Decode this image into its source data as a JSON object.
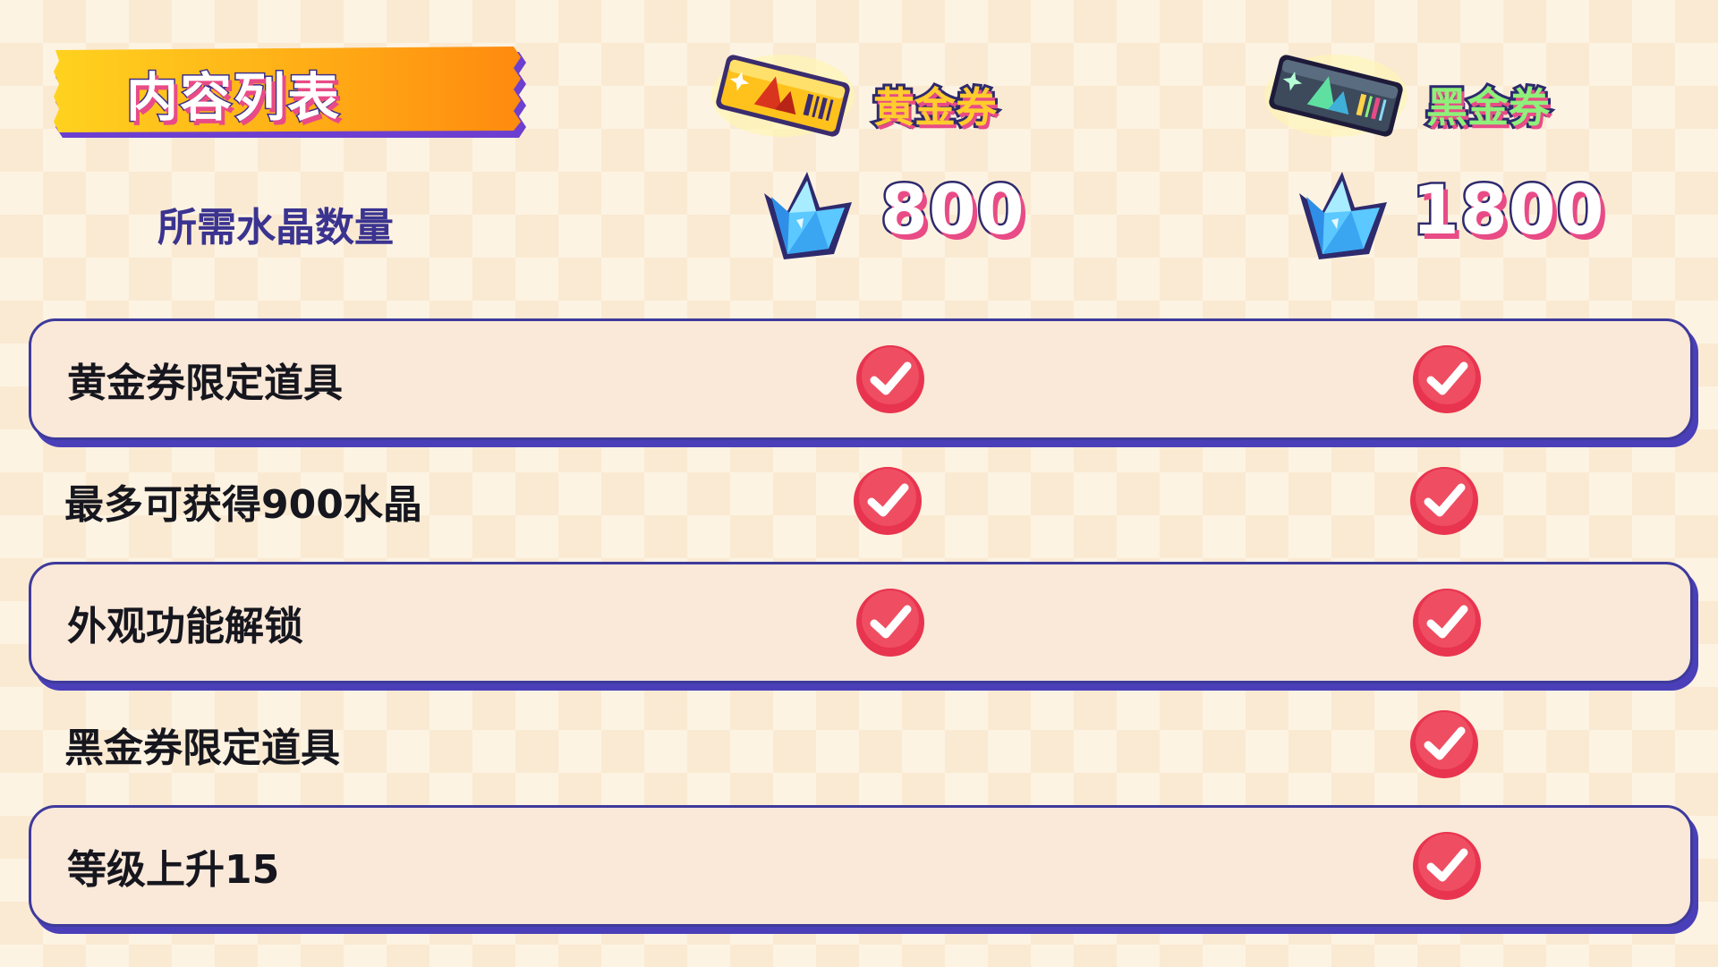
{
  "header": {
    "title": "内容列表",
    "crystal_label": "所需水晶数量"
  },
  "passes": {
    "gold": {
      "name": "黄金券",
      "price": "800",
      "icon": "gold-ticket-icon"
    },
    "black": {
      "name": "黑金券",
      "price": "1800",
      "icon": "black-ticket-icon"
    }
  },
  "currency_icon": "crystal-icon",
  "rows": [
    {
      "label": "黄金券限定道具",
      "gold": true,
      "black": true
    },
    {
      "label": "最多可获得900水晶",
      "gold": true,
      "black": true
    },
    {
      "label": "外观功能解锁",
      "gold": true,
      "black": true
    },
    {
      "label": "黑金券限定道具",
      "gold": false,
      "black": true
    },
    {
      "label": "等级上升15",
      "gold": false,
      "black": true
    }
  ],
  "colors": {
    "check": "#e8344f",
    "row_border": "#3e3a9c",
    "row_fill": "#fae8d8",
    "accent_pink": "#e84b86"
  }
}
